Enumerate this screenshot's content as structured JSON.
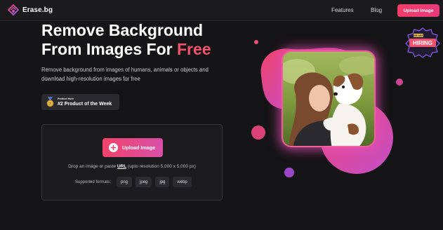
{
  "nav": {
    "logo_text": "Erase.bg",
    "links": [
      "Features",
      "Blog"
    ],
    "upload_label": "Upload Image"
  },
  "hero": {
    "headline_line1": "Remove Background",
    "headline_line2_main": "From Images For ",
    "headline_line2_accent": "Free",
    "subtitle": "Remove background from images of humans, animals or objects and download high-resolution images for free",
    "badge": {
      "small_text": "Product Hunt",
      "main_text": "#2 Product of the Week"
    }
  },
  "upload_card": {
    "button_label": "Upload Image",
    "drop_prefix": "Drop an image or paste ",
    "drop_url": "URL",
    "drop_suffix": " (upto resolution 5,000 x 5,000 px)",
    "formats_label": "Supported formats:",
    "formats": [
      "png",
      "jpeg",
      "jpg",
      "webp"
    ]
  },
  "hiring_badge": {
    "top_text": "WE ARE",
    "main_text": "HIRING"
  },
  "colors": {
    "accent": "#f0516c",
    "background": "#151416",
    "button_gradient_start": "#f2436b",
    "button_gradient_end": "#d84fa8"
  },
  "icons": [
    "erase-bg-logo-icon",
    "medal-icon",
    "upload-plus-icon"
  ]
}
